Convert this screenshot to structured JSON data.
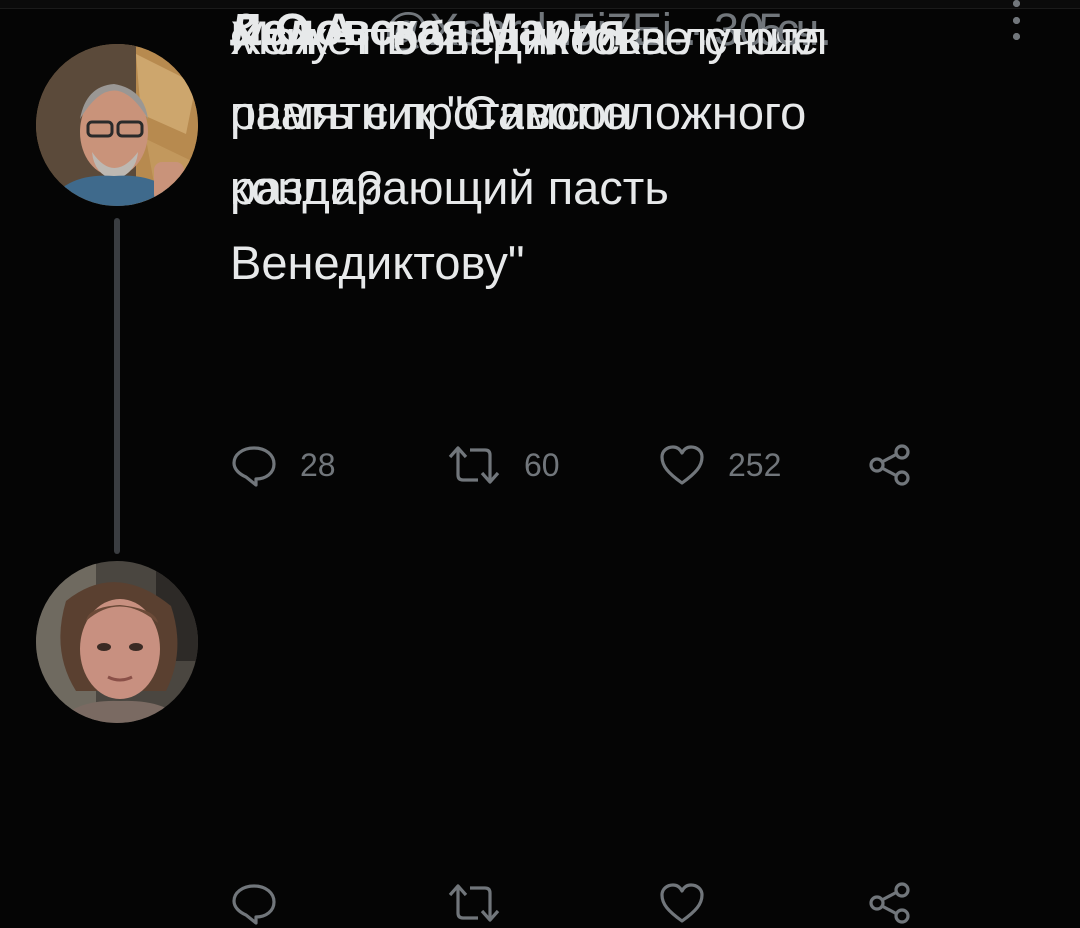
{
  "tweets": [
    {
      "display_name": "&.О.А.",
      "handle": "@Xshrdn5i7Ei...",
      "separator": "·",
      "time": "5 ч.",
      "text_lines": [
        "Хочу чтобы в Москве стоял",
        "памятник \"Самсон",
        "раздирающий пасть",
        "Венедиктову\""
      ],
      "reply_count": "28",
      "retweet_count": "60",
      "like_count": "252"
    },
    {
      "display_name": "Ледовская Мария",
      "name_ellipsis": "...",
      "separator": "·",
      "time": "30 с.",
      "text_lines": [
        "Может Венедиктова лучше",
        "рвать с противоположного",
        "конца?"
      ]
    }
  ],
  "icons": {
    "reply": "reply-icon",
    "retweet": "retweet-icon",
    "like": "heart-icon",
    "share": "share-icon",
    "more": "more-icon"
  },
  "colors": {
    "background": "#050505",
    "text": "#e7e9ea",
    "muted": "#71767b",
    "thread_line": "#3a3d41"
  }
}
